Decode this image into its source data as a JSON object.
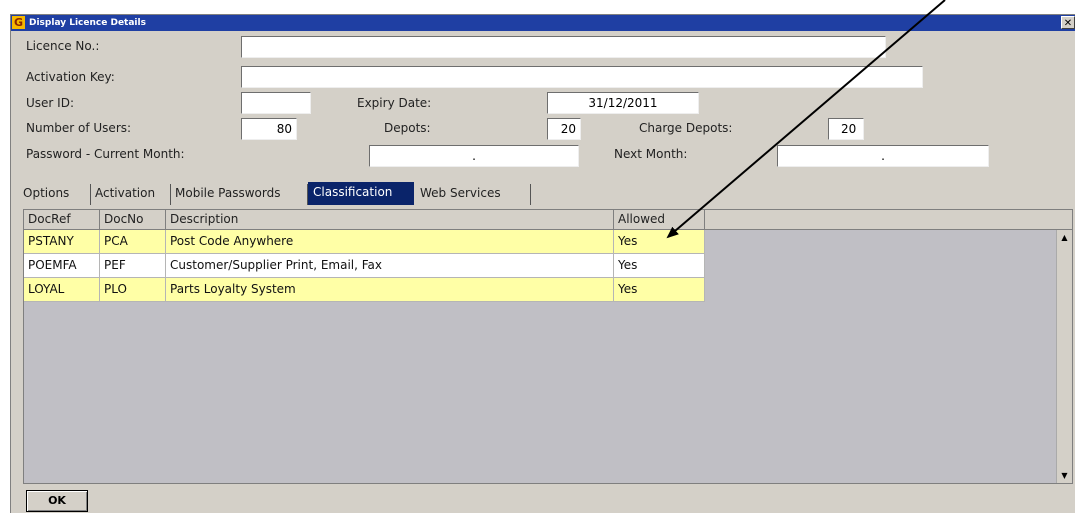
{
  "window": {
    "title": "Display Licence Details",
    "app_icon": "G",
    "close_glyph": "✕"
  },
  "form": {
    "licence_no": {
      "label": "Licence No.:",
      "value": ""
    },
    "activation_key": {
      "label": "Activation Key:",
      "value": ""
    },
    "user_id": {
      "label": "User ID:",
      "value": ""
    },
    "expiry_date": {
      "label": "Expiry Date:",
      "value": "31/12/2011"
    },
    "number_of_users": {
      "label": "Number of Users:",
      "value": "80"
    },
    "depots": {
      "label": "Depots:",
      "value": "20"
    },
    "charge_depots": {
      "label": "Charge Depots:",
      "value": "20"
    },
    "password_current_month": {
      "label": "Password - Current Month:",
      "value": "."
    },
    "next_month": {
      "label": "Next Month:",
      "value": "."
    }
  },
  "tabs": [
    "Options",
    "Activation",
    "Mobile Passwords",
    "Classification",
    "Web Services"
  ],
  "active_tab": "Classification",
  "grid": {
    "columns": [
      "DocRef",
      "DocNo",
      "Description",
      "Allowed"
    ],
    "rows": [
      {
        "docref": "PSTANY",
        "docno": "PCA",
        "description": "Post Code Anywhere",
        "allowed": "Yes"
      },
      {
        "docref": "POEMFA",
        "docno": "PEF",
        "description": "Customer/Supplier Print, Email, Fax",
        "allowed": "Yes"
      },
      {
        "docref": "LOYAL",
        "docno": "PLO",
        "description": "Parts Loyalty System",
        "allowed": "Yes"
      }
    ]
  },
  "ok_button": "OK",
  "colors": {
    "titlebar": "#1f3fa3",
    "active_tab": "#0a246a",
    "row_highlight": "#ffffa6",
    "grid_background": "#c0bfc5",
    "annotation_arrow": "#000000"
  },
  "icons": {
    "app": "app-logo-icon",
    "close": "close-icon",
    "scroll_up": "scroll-up-icon",
    "scroll_down": "scroll-down-icon",
    "annotation": "arrow-annotation"
  }
}
